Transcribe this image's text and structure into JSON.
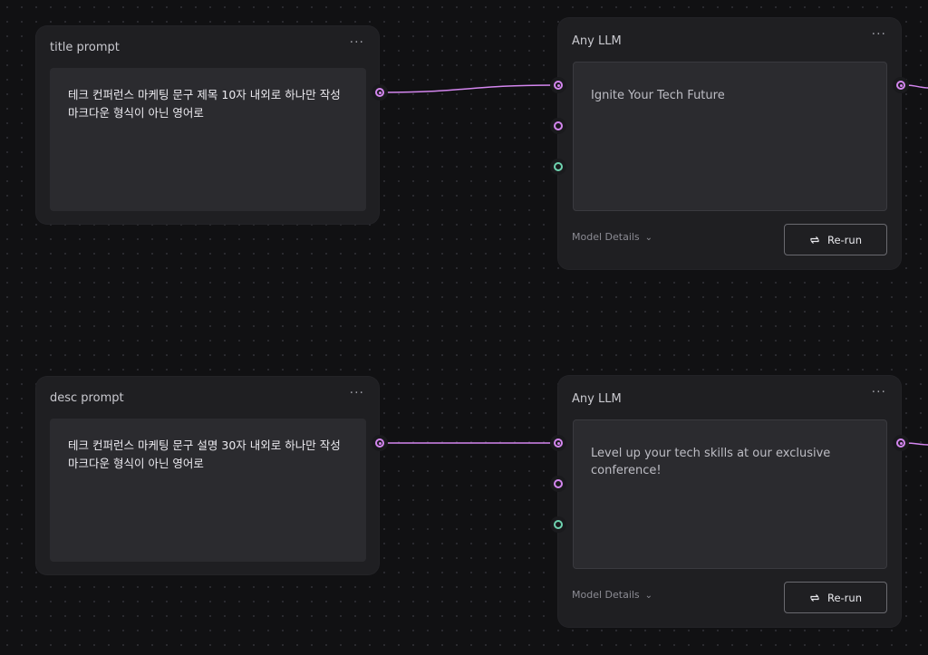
{
  "nodes": {
    "title_prompt": {
      "title": "title prompt",
      "menu": "···",
      "text": "테크 컨퍼런스 마케팅 문구 제목 10자 내외로 하나만 작성 마크다운 형식이 아닌 영어로"
    },
    "desc_prompt": {
      "title": "desc prompt",
      "menu": "···",
      "text": "테크 컨퍼런스 마케팅 문구 설명 30자 내외로 하나만 작성 마크다운 형식이 아닌 영어로"
    },
    "llm_1": {
      "title": "Any LLM",
      "menu": "···",
      "output": "Ignite Your Tech Future",
      "model_details": "Model Details",
      "rerun": "Re-run"
    },
    "llm_2": {
      "title": "Any LLM",
      "menu": "···",
      "output": "Level up your tech skills at our exclusive conference!",
      "model_details": "Model Details",
      "rerun": "Re-run"
    }
  },
  "colors": {
    "port_text": "#d486ef",
    "port_aux": "#6fd3b0",
    "edge": "#d486ef"
  },
  "icons": [
    "more-icon",
    "chevron-down-icon",
    "refresh-icon"
  ]
}
